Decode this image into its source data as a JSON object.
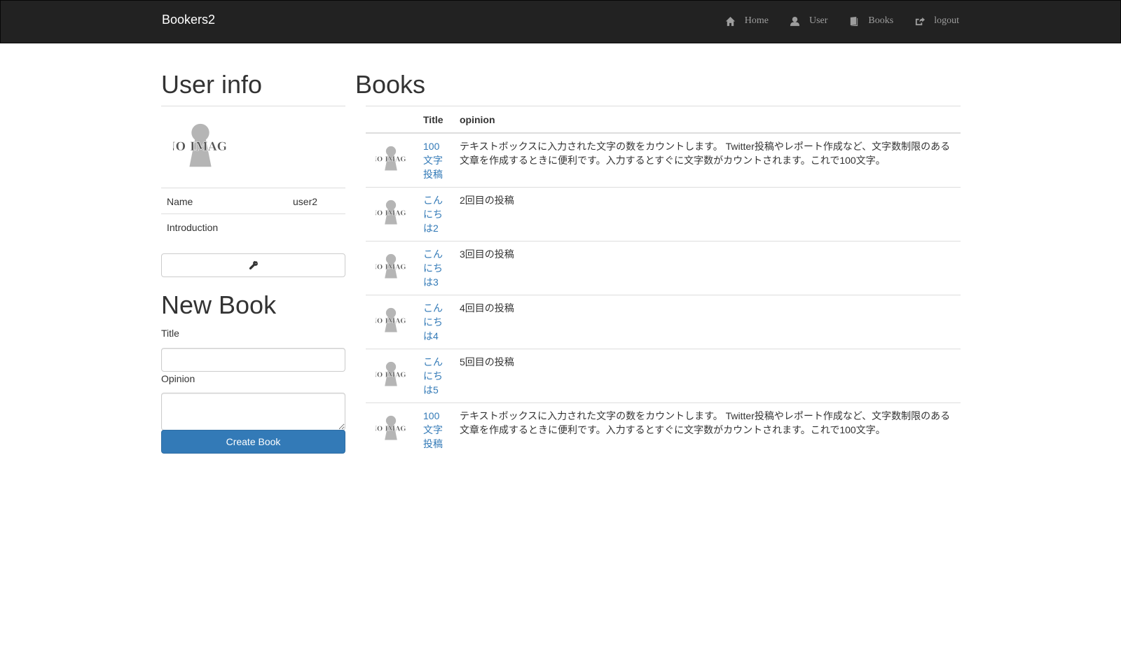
{
  "navbar": {
    "brand": "Bookers2",
    "items": [
      {
        "label": "Home",
        "icon": "home-icon"
      },
      {
        "label": "User",
        "icon": "user-icon"
      },
      {
        "label": "Books",
        "icon": "book-icon"
      },
      {
        "label": "logout",
        "icon": "logout-icon"
      }
    ]
  },
  "user_info": {
    "heading": "User info",
    "avatar_text": "NO IMAGE",
    "rows": [
      {
        "key": "Name",
        "value": "user2"
      },
      {
        "key": "Introduction",
        "value": ""
      }
    ],
    "edit_icon": "wrench-icon"
  },
  "new_book": {
    "heading": "New Book",
    "title_label": "Title",
    "title_value": "",
    "opinion_label": "Opinion",
    "opinion_value": "",
    "submit_label": "Create Book"
  },
  "books": {
    "heading": "Books",
    "columns": [
      "",
      "Title",
      "opinion"
    ],
    "rows": [
      {
        "thumb": "NO IMAGE",
        "title": "100文字投稿",
        "opinion": "テキストボックスに入力された文字の数をカウントします。 Twitter投稿やレポート作成など、文字数制限のある文章を作成するときに便利です。入力するとすぐに文字数がカウントされます。これで100文字。"
      },
      {
        "thumb": "NO IMAGE",
        "title": "こんにちは2",
        "opinion": "2回目の投稿"
      },
      {
        "thumb": "NO IMAGE",
        "title": "こんにちは3",
        "opinion": "3回目の投稿"
      },
      {
        "thumb": "NO IMAGE",
        "title": "こんにちは4",
        "opinion": "4回目の投稿"
      },
      {
        "thumb": "NO IMAGE",
        "title": "こんにちは5",
        "opinion": "5回目の投稿"
      },
      {
        "thumb": "NO IMAGE",
        "title": "100文字投稿",
        "opinion": "テキストボックスに入力された文字の数をカウントします。 Twitter投稿やレポート作成など、文字数制限のある文章を作成するときに便利です。入力するとすぐに文字数がカウントされます。これで100文字。"
      }
    ]
  },
  "colors": {
    "navbar_bg": "#222222",
    "nav_text": "#9d9d9d",
    "link": "#337ab7",
    "primary_button": "#337ab7"
  }
}
